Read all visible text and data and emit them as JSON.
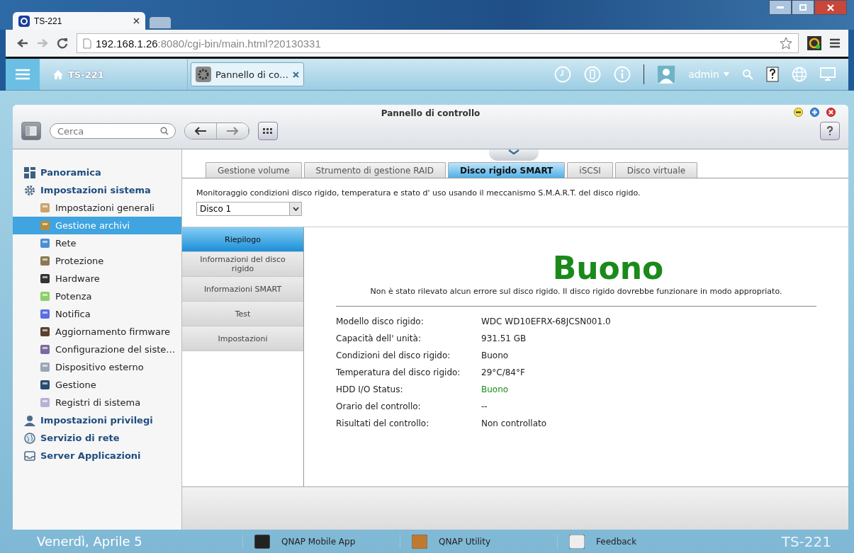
{
  "browser": {
    "tabs": [
      {
        "title": "TS-221",
        "selected": true
      }
    ],
    "url_host": "192.168.1.26",
    "url_rest": ":8080/cgi-bin/main.html?20130331"
  },
  "top_bar": {
    "device": "TS-221",
    "app_tabs": [
      {
        "label": "Pannello di co…"
      }
    ],
    "user": "admin"
  },
  "window": {
    "title": "Pannello di controllo",
    "search_placeholder": "Cerca"
  },
  "sidebar": [
    {
      "label": "Panoramica",
      "selected": false
    },
    {
      "label": "Impostazioni sistema",
      "selected": false,
      "children": [
        {
          "label": "Impostazioni generali",
          "selected": false
        },
        {
          "label": "Gestione archivi",
          "selected": true
        },
        {
          "label": "Rete",
          "selected": false
        },
        {
          "label": "Protezione",
          "selected": false
        },
        {
          "label": "Hardware",
          "selected": false
        },
        {
          "label": "Potenza",
          "selected": false
        },
        {
          "label": "Notifica",
          "selected": false
        },
        {
          "label": "Aggiornamento firmware",
          "selected": false
        },
        {
          "label": "Configurazione del siste…",
          "selected": false
        },
        {
          "label": "Dispositivo esterno",
          "selected": false
        },
        {
          "label": "Gestione",
          "selected": false
        },
        {
          "label": "Registri di sistema",
          "selected": false
        }
      ]
    },
    {
      "label": "Impostazioni privilegi",
      "selected": false
    },
    {
      "label": "Servizio di rete",
      "selected": false
    },
    {
      "label": "Server Applicazioni",
      "selected": false
    }
  ],
  "tabs": [
    {
      "label": "Gestione volume",
      "selected": false
    },
    {
      "label": "Strumento di gestione RAID",
      "selected": false
    },
    {
      "label": "Disco rigido SMART",
      "selected": true
    },
    {
      "label": "iSCSI",
      "selected": false
    },
    {
      "label": "Disco virtuale",
      "selected": false
    }
  ],
  "description": "Monitoraggio condizioni disco rigido, temperatura e stato d'  uso usando il meccanismo S.M.A.R.T. del disco rigido.",
  "disk_select": {
    "value": "Disco 1"
  },
  "subnav": [
    {
      "label": "Riepilogo",
      "selected": true
    },
    {
      "label": "Informazioni del disco rigido",
      "selected": false
    },
    {
      "label": "Informazioni SMART",
      "selected": false
    },
    {
      "label": "Test",
      "selected": false
    },
    {
      "label": "Impostazioni",
      "selected": false
    }
  ],
  "status": {
    "headline": "Buono",
    "message": "Non è stato rilevato alcun errore sul disco rigido. Il disco rigido dovrebbe funzionare in modo appropriato."
  },
  "details": [
    {
      "label": "Modello disco rigido:",
      "value": "WDC WD10EFRX-68JCSN001.0",
      "kind": "plain"
    },
    {
      "label": "Capacità dell'  unità:",
      "value": "931.51 GB",
      "kind": "plain"
    },
    {
      "label": "Condizioni del disco rigido:",
      "value": "Buono",
      "kind": "plain"
    },
    {
      "label": "Temperatura del disco rigido:",
      "value": "29°C/84°F",
      "kind": "plain"
    },
    {
      "label": "HDD I/O Status:",
      "value": "Buono",
      "kind": "good"
    },
    {
      "label": "Orario del controllo:",
      "value": "--",
      "kind": "plain"
    },
    {
      "label": "Risultati del controllo:",
      "value": "Non controllato",
      "kind": "plain"
    }
  ],
  "desktop": {
    "date": "Venerdì, Aprile 5",
    "shortcuts": [
      {
        "label": "QNAP Mobile App"
      },
      {
        "label": "QNAP Utility"
      },
      {
        "label": "Feedback"
      }
    ],
    "logo": "TS-221"
  }
}
